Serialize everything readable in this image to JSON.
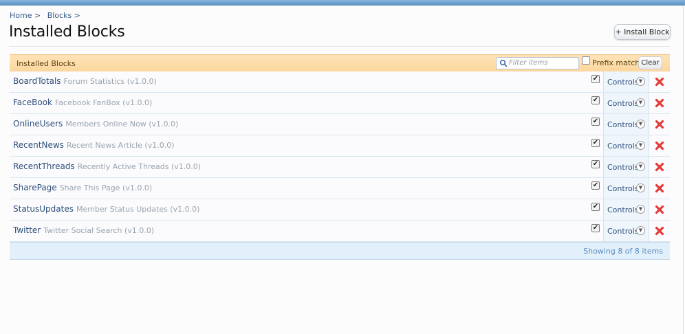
{
  "breadcrumb": [
    "Home >",
    "Blocks >"
  ],
  "page_title": "Installed Blocks",
  "install_button": "+ Install Block",
  "list": {
    "header_title": "Installed Blocks",
    "filter_placeholder": "Filter items",
    "prefix_label": "Prefix match",
    "clear_label": "Clear",
    "controls_label": "Controls",
    "items": [
      {
        "title": "BoardTotals",
        "desc": "Forum Statistics (v1.0.0)",
        "enabled": true
      },
      {
        "title": "FaceBook",
        "desc": "Facebook FanBox (v1.0.0)",
        "enabled": true
      },
      {
        "title": "OnlineUsers",
        "desc": "Members Online Now (v1.0.0)",
        "enabled": true
      },
      {
        "title": "RecentNews",
        "desc": "Recent News Article (v1.0.0)",
        "enabled": true
      },
      {
        "title": "RecentThreads",
        "desc": "Recently Active Threads (v1.0.0)",
        "enabled": true
      },
      {
        "title": "SharePage",
        "desc": "Share This Page (v1.0.0)",
        "enabled": true
      },
      {
        "title": "StatusUpdates",
        "desc": "Member Status Updates (v1.0.0)",
        "enabled": true
      },
      {
        "title": "Twitter",
        "desc": "Twitter Social Search (v1.0.0)",
        "enabled": true
      }
    ],
    "footer": "Showing 8 of 8 items"
  },
  "icons": {
    "search": "search-icon",
    "checkbox": "checkbox-icon",
    "dropdown": "chevron-down-icon",
    "delete": "delete-icon"
  },
  "colors": {
    "header_bg": "#fcd79d",
    "link": "#2f4f7a",
    "footer_bg": "#e2f0fb",
    "delete_red": "#e23b3b"
  }
}
